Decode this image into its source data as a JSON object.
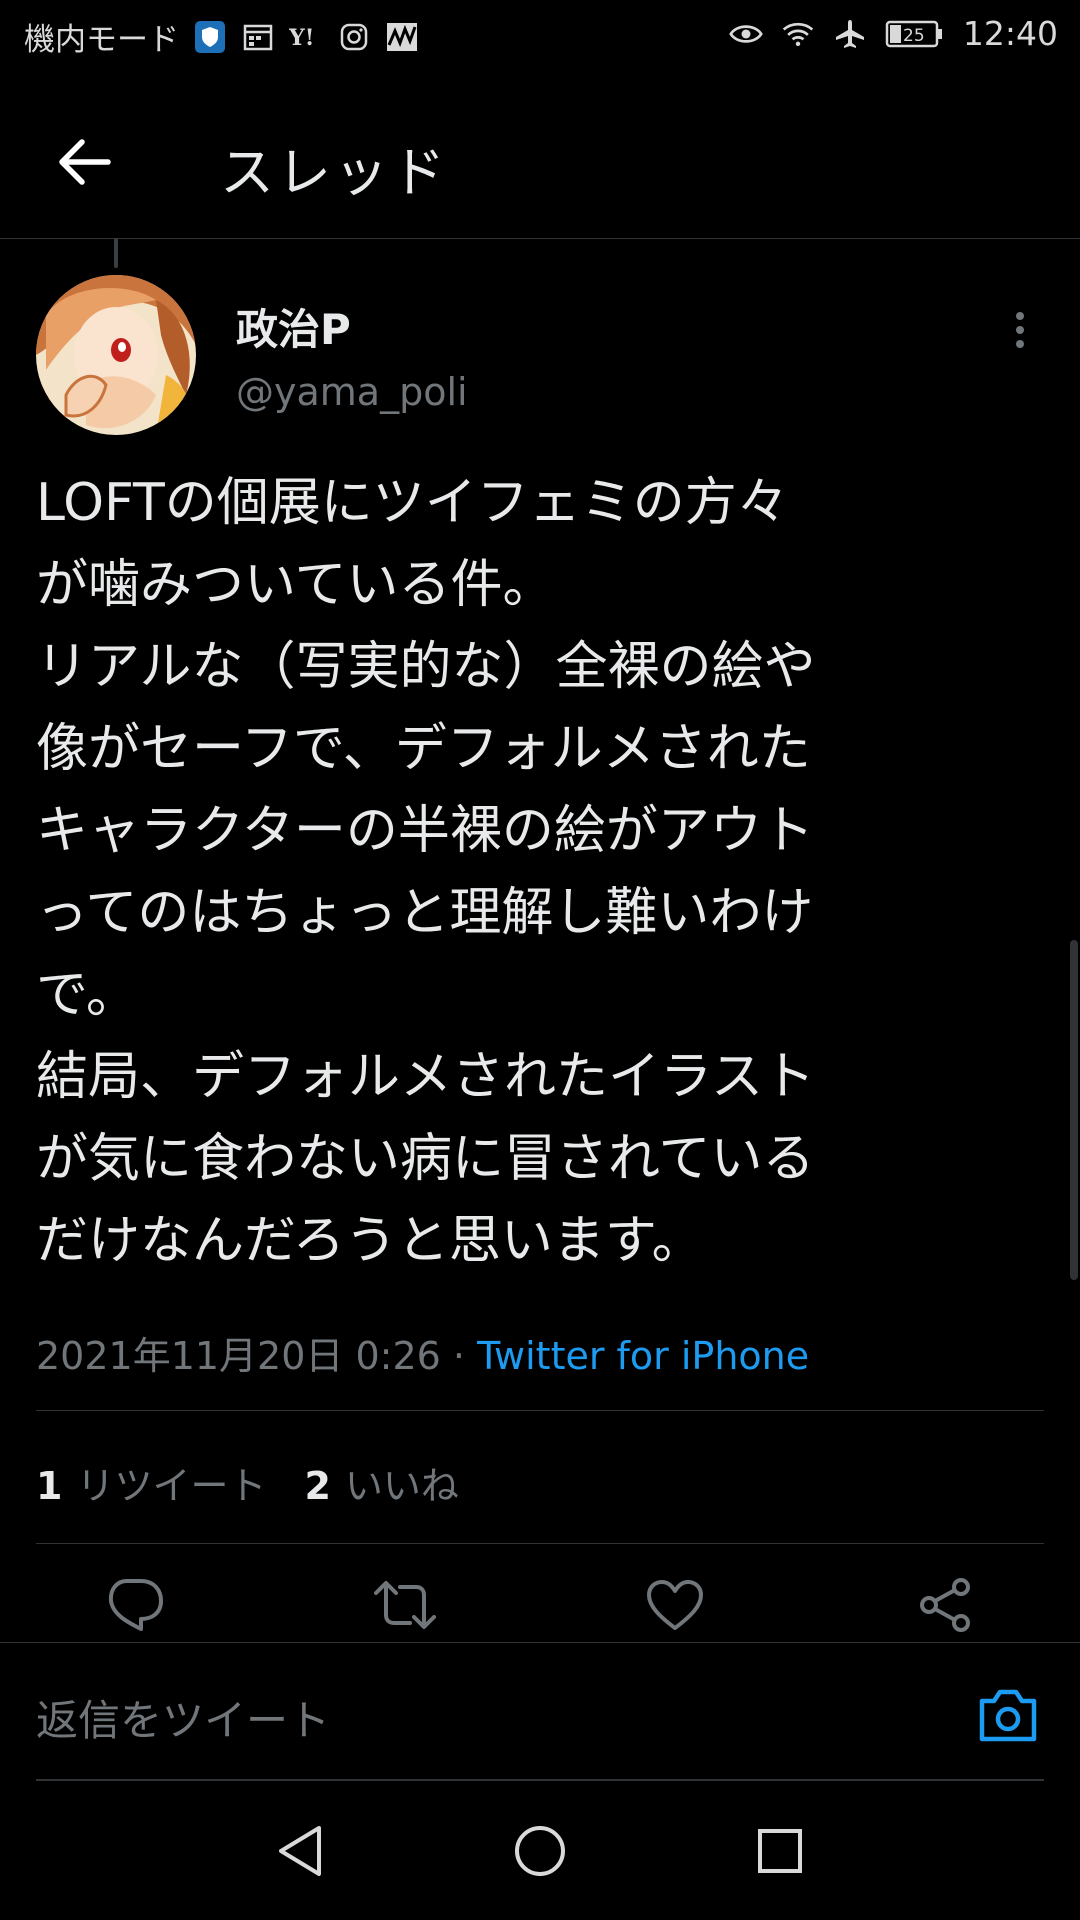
{
  "status_bar": {
    "left_text": "機内モード",
    "time": "12:40",
    "battery": "25",
    "left_icons": [
      "shield-icon",
      "calendar-icon",
      "yahoo-icon",
      "instagram-icon",
      "activity-icon"
    ],
    "right_icons": [
      "eye-icon",
      "wifi-icon",
      "airplane-icon",
      "battery-icon"
    ]
  },
  "header": {
    "title": "スレッド"
  },
  "tweet": {
    "display_name": "政治P",
    "handle": "@yama_poli",
    "lines": [
      "LOFTの個展にツイフェミの方々",
      "が噛みついている件。",
      "リアルな（写実的な）全裸の絵や",
      "像がセーフで、デフォルメされた",
      "キャラクターの半裸の絵がアウト",
      "ってのはちょっと理解し難いわけ",
      "で。",
      "結局、デフォルメされたイラスト",
      "が気に食わない病に冒されている",
      "だけなんだろうと思います。"
    ],
    "timestamp": "2021年11月20日 0:26",
    "separator": "·",
    "source": "Twitter for iPhone",
    "retweet_count": "1",
    "retweet_label": "リツイート",
    "like_count": "2",
    "like_label": "いいね"
  },
  "actions": [
    "reply-icon",
    "retweet-icon",
    "like-icon",
    "share-icon"
  ],
  "reply": {
    "placeholder": "返信をツイート"
  },
  "colors": {
    "background": "#000000",
    "text": "#e7e9ea",
    "muted": "#71767b",
    "accent": "#1d9bf0",
    "divider": "#2f3336"
  }
}
